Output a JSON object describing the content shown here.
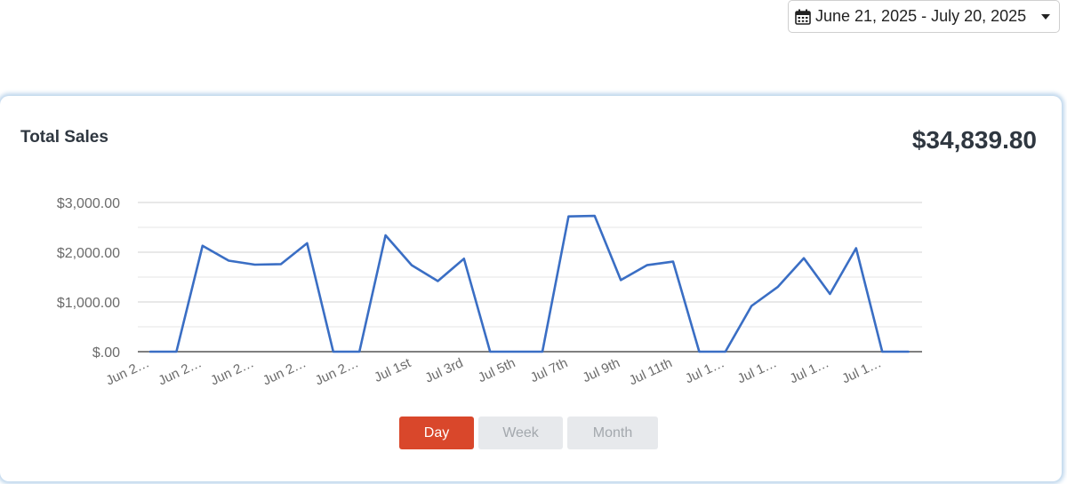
{
  "date_range": {
    "label": "June 21, 2025 - July 20, 2025",
    "icon": "calendar-icon"
  },
  "card": {
    "title": "Total Sales",
    "total": "$34,839.80"
  },
  "range_buttons": [
    {
      "label": "Day",
      "active": true,
      "color": "#d9472b"
    },
    {
      "label": "Week",
      "active": false
    },
    {
      "label": "Month",
      "active": false
    }
  ],
  "chart_data": {
    "type": "line",
    "title": "",
    "xlabel": "",
    "ylabel": "",
    "ylim": [
      0,
      3000
    ],
    "grid": true,
    "line_color": "#3a6ec4",
    "y_ticks": [
      "$.00",
      "$1,000.00",
      "$2,000.00",
      "$3,000.00"
    ],
    "x_tick_labels": [
      "Jun 2…",
      "Jun 2…",
      "Jun 2…",
      "Jun 2…",
      "Jun 2…",
      "Jul 1st",
      "Jul 3rd",
      "Jul 5th",
      "Jul 7th",
      "Jul 9th",
      "Jul 11th",
      "Jul 1…",
      "Jul 1…",
      "Jul 1…",
      "Jul 1…"
    ],
    "series": [
      {
        "values": [
          0,
          0,
          2130,
          1830,
          1750,
          1760,
          2180,
          0,
          0,
          2340,
          1740,
          1420,
          1870,
          0,
          0,
          0,
          2720,
          2730,
          1440,
          1740,
          1810,
          0,
          0,
          920,
          1300,
          1880,
          1160,
          2080,
          0,
          0
        ]
      }
    ]
  }
}
